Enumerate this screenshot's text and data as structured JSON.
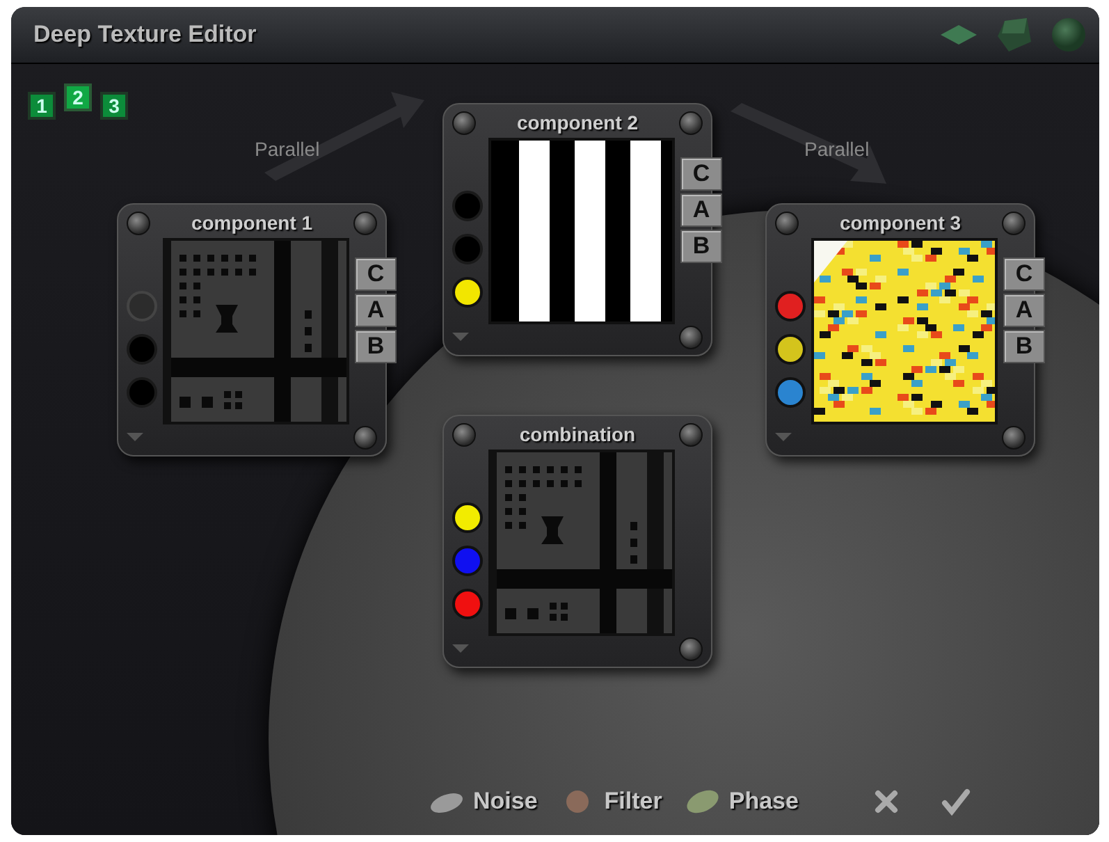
{
  "window": {
    "title": "Deep Texture Editor"
  },
  "pages": [
    {
      "label": "1",
      "selected": false
    },
    {
      "label": "2",
      "selected": true
    },
    {
      "label": "3",
      "selected": false
    }
  ],
  "links": [
    {
      "label": "Parallel"
    },
    {
      "label": "Parallel"
    }
  ],
  "panels": [
    {
      "title": "component 1",
      "kind": "maze",
      "inputs": [
        {
          "kind": "empty"
        },
        {
          "kind": "hole"
        },
        {
          "kind": "hole"
        }
      ],
      "channels": [
        "C",
        "A",
        "B"
      ]
    },
    {
      "title": "component 2",
      "kind": "stripes",
      "inputs": [
        {
          "kind": "hole"
        },
        {
          "kind": "hole"
        },
        {
          "kind": "dot",
          "color": "#f2e600"
        }
      ],
      "channels": [
        "C",
        "A",
        "B"
      ]
    },
    {
      "title": "component 3",
      "kind": "noise",
      "inputs": [
        {
          "kind": "dot",
          "color": "#e02020"
        },
        {
          "kind": "dot",
          "color": "#d4c41c"
        },
        {
          "kind": "dot",
          "color": "#2a84d0"
        }
      ],
      "channels": [
        "C",
        "A",
        "B"
      ]
    },
    {
      "title": "combination",
      "kind": "maze",
      "inputs": [
        {
          "kind": "dot",
          "color": "#f2ec00"
        },
        {
          "kind": "dot",
          "color": "#1010f0"
        },
        {
          "kind": "dot",
          "color": "#f01010"
        }
      ]
    }
  ],
  "toolbar": [
    {
      "label": "Noise",
      "kind": "noise"
    },
    {
      "label": "Filter",
      "kind": "filter"
    },
    {
      "label": "Phase",
      "kind": "phase"
    }
  ]
}
